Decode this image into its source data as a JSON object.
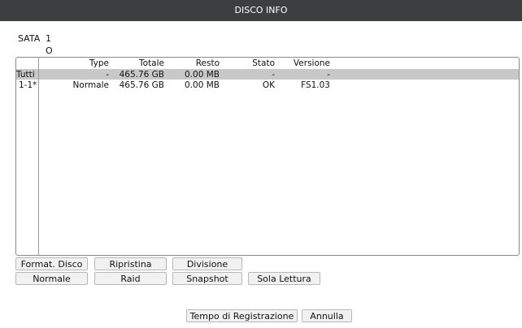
{
  "window": {
    "title": "DISCO INFO"
  },
  "sata": {
    "label": "SATA",
    "number": "1",
    "status": "O"
  },
  "table": {
    "headers": {
      "type": "Type",
      "totale": "Totale",
      "resto": "Resto",
      "stato": "Stato",
      "versione": "Versione"
    },
    "rows": [
      {
        "name": "Tutti",
        "type": "-",
        "totale": "465.76 GB",
        "resto": "0.00 MB",
        "stato": "-",
        "versione": "-"
      },
      {
        "name": "1-1*",
        "type": "Normale",
        "totale": "465.76 GB",
        "resto": "0.00 MB",
        "stato": "OK",
        "versione": "FS1.03"
      }
    ]
  },
  "buttons": {
    "format": "Format. Disco",
    "ripristina": "Ripristina",
    "divisione": "Divisione",
    "normale": "Normale",
    "raid": "Raid",
    "snapshot": "Snapshot",
    "sola_lettura": "Sola Lettura",
    "tempo": "Tempo di Registrazione",
    "annulla": "Annulla"
  }
}
